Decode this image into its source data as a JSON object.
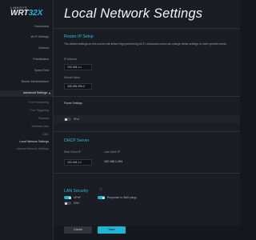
{
  "brand": {
    "maker": "LINKSYS",
    "model_prefix": "WRT",
    "model_suffix": "32X"
  },
  "sidebar": {
    "items": [
      {
        "label": "Dashboard",
        "level": "top"
      },
      {
        "label": "Wi-Fi Settings",
        "level": "top"
      },
      {
        "label": "Devices",
        "level": "top"
      },
      {
        "label": "Prioritization",
        "level": "top"
      },
      {
        "label": "Speed Test",
        "level": "top"
      },
      {
        "label": "Router Administration",
        "level": "top"
      },
      {
        "label": "Advanced Settings",
        "level": "top",
        "active": true
      },
      {
        "label": "Port Forwarding",
        "level": "sub"
      },
      {
        "label": "Port Triggering",
        "level": "sub"
      },
      {
        "label": "Parental",
        "level": "sub"
      },
      {
        "label": "Wireless Mac",
        "level": "sub"
      },
      {
        "label": "DMZ",
        "level": "sub"
      },
      {
        "label": "Local Network Settings",
        "level": "sub",
        "active": true
      },
      {
        "label": "Internet Network Settings",
        "level": "sub"
      }
    ]
  },
  "page": {
    "title": "Local Network Settings"
  },
  "router_ip": {
    "title": "Router IP Setup",
    "description": "The default settings on this screen will deliver high performing Wi-Fi. Advanced users can change these settings to meet specific needs.",
    "ip_label": "IP Address",
    "ip_value": "192.168.1.1",
    "subnet_label": "Subnet Mask",
    "subnet_value": "255.255.255.0"
  },
  "power": {
    "title": "Power Settings",
    "option_label": "IPv4",
    "enabled": false
  },
  "dhcp": {
    "title": "DHCP Server",
    "start_label": "Start Client IP",
    "start_value": "192.168.1.2",
    "end_label": "Last Client IP",
    "end_value": "192.168.1.254"
  },
  "lan": {
    "title": "LAN Security",
    "info_icon": "info-icon",
    "upnp_label": "UPnP",
    "upnp_enabled": true,
    "ssh_label": "SSH",
    "ssh_enabled": false,
    "ping_label": "Response to WAN pings",
    "ping_enabled": true
  },
  "actions": {
    "cancel_label": "Cancel",
    "save_label": "Save"
  },
  "colors": {
    "accent": "#1fb6d6",
    "background": "#1a1e24",
    "sidebar": "#181b21"
  }
}
